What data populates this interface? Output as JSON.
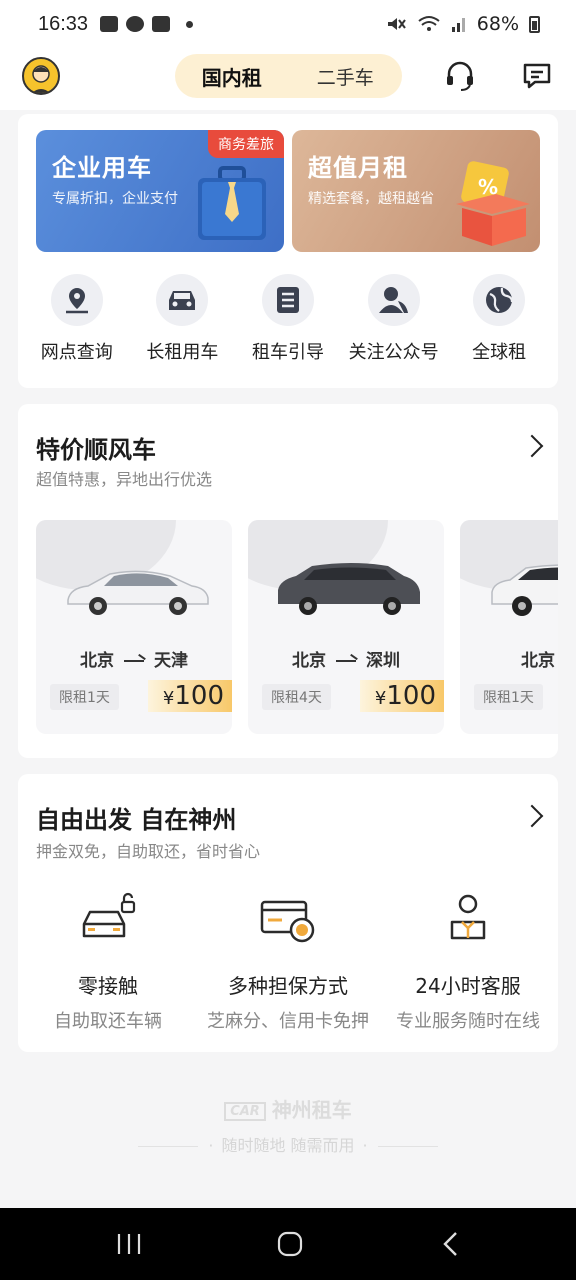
{
  "status_bar": {
    "time": "16:33",
    "battery": "68%"
  },
  "header": {
    "tabs": [
      {
        "label": "国内租",
        "active": true
      },
      {
        "label": "二手车",
        "active": false
      }
    ],
    "icons": [
      "avatar",
      "headset-icon",
      "message-icon"
    ]
  },
  "banners": [
    {
      "title": "企业用车",
      "subtitle": "专属折扣，企业支付",
      "tag": "商务差旅",
      "color": "#4f84d6"
    },
    {
      "title": "超值月租",
      "subtitle": "精选套餐，越租越省",
      "color": "#c9977a"
    }
  ],
  "quick_links": [
    {
      "label": "网点查询",
      "icon": "location-pin-icon"
    },
    {
      "label": "长租用车",
      "icon": "car-icon"
    },
    {
      "label": "租车引导",
      "icon": "document-icon"
    },
    {
      "label": "关注公众号",
      "icon": "user-icon"
    },
    {
      "label": "全球租",
      "icon": "globe-icon"
    }
  ],
  "deals_section": {
    "title": "特价顺风车",
    "subtitle": "超值特惠，异地出行优选",
    "items": [
      {
        "from": "北京",
        "to": "天津",
        "limit": "限租1天",
        "currency": "¥",
        "price": "100",
        "car_color": "white"
      },
      {
        "from": "北京",
        "to": "深圳",
        "limit": "限租4天",
        "currency": "¥",
        "price": "100",
        "car_color": "dark-grey"
      },
      {
        "from": "北京",
        "to": "",
        "limit": "限租1天",
        "currency": "",
        "price": "",
        "car_color": "white-suv"
      }
    ]
  },
  "features_section": {
    "title": "自由出发 自在神州",
    "subtitle": "押金双免，自助取还，省时省心",
    "items": [
      {
        "title": "零接触",
        "subtitle": "自助取还车辆",
        "icon": "car-lock-icon"
      },
      {
        "title": "多种担保方式",
        "subtitle": "芝麻分、信用卡免押",
        "icon": "card-coin-icon"
      },
      {
        "title": "24小时客服",
        "subtitle": "专业服务随时在线",
        "icon": "agent-icon"
      }
    ]
  },
  "footer": {
    "brand": "神州租车",
    "mark": "CAR",
    "slogan": "随时随地 随需而用"
  },
  "colors": {
    "accent": "#f8c33c",
    "tab_bg": "#fdf0d3",
    "price_bg": "#f8c869"
  }
}
